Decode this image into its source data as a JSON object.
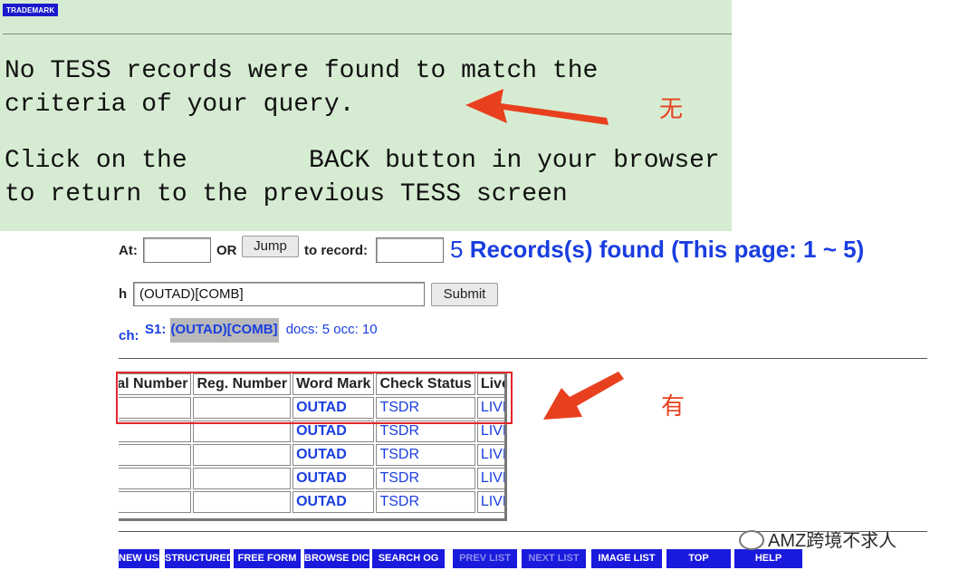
{
  "green_panel": {
    "badge": "TRADEMARK",
    "message_line1": "No TESS records were found to match the",
    "message_line2": "criteria of your query.",
    "back_line1": "Click on the        BACK button in your browser",
    "back_line2": "to return to the previous TESS screen"
  },
  "annotations": {
    "none": "无",
    "have": "有",
    "arrow_color": "#e8401e"
  },
  "search_bar": {
    "at_label": "At:",
    "at_value": "",
    "or_label": "OR",
    "jump_label": "Jump",
    "to_record_label": "to record:",
    "to_record_value": "",
    "records_count": "5",
    "records_text": "Records(s) found (This page: 1 ~ 5)"
  },
  "query": {
    "label": "h",
    "value": "(OUTAD)[COMB]",
    "submit_label": "Submit"
  },
  "search_summary": {
    "ch_label": "ch:",
    "s1_label": "S1:",
    "s1_query": "(OUTAD)[COMB]",
    "s1_stats": "docs: 5 occ: 10"
  },
  "results_table": {
    "headers": [
      "Serial Number",
      "Reg. Number",
      "Word Mark",
      "Check Status",
      "Live/Dead"
    ],
    "rows": [
      [
        "",
        "",
        "OUTAD",
        "TSDR",
        "LIVE"
      ],
      [
        "",
        "",
        "OUTAD",
        "TSDR",
        "LIVE"
      ],
      [
        "",
        "",
        "OUTAD",
        "TSDR",
        "LIVE"
      ],
      [
        "",
        "",
        "OUTAD",
        "TSDR",
        "LIVE"
      ],
      [
        "",
        "",
        "OUTAD",
        "TSDR",
        "LIVE"
      ]
    ]
  },
  "nav_buttons": [
    {
      "label": "NEW USER",
      "enabled": true
    },
    {
      "label": "STRUCTURED",
      "enabled": true
    },
    {
      "label": "FREE FORM",
      "enabled": true
    },
    {
      "label": "BROWSE DICT",
      "enabled": true
    },
    {
      "label": "SEARCH OG",
      "enabled": true
    },
    {
      "label": "PREV LIST",
      "enabled": false
    },
    {
      "label": "NEXT LIST",
      "enabled": false
    },
    {
      "label": "IMAGE LIST",
      "enabled": true
    },
    {
      "label": "TOP",
      "enabled": true
    },
    {
      "label": "HELP",
      "enabled": true
    }
  ],
  "watermark": "AMZ跨境不求人",
  "colors": {
    "panel_green": "#d6ecd2",
    "link_blue": "#1a3ee0",
    "nav_blue": "#1a1add",
    "highlight_red": "#e6262a"
  }
}
